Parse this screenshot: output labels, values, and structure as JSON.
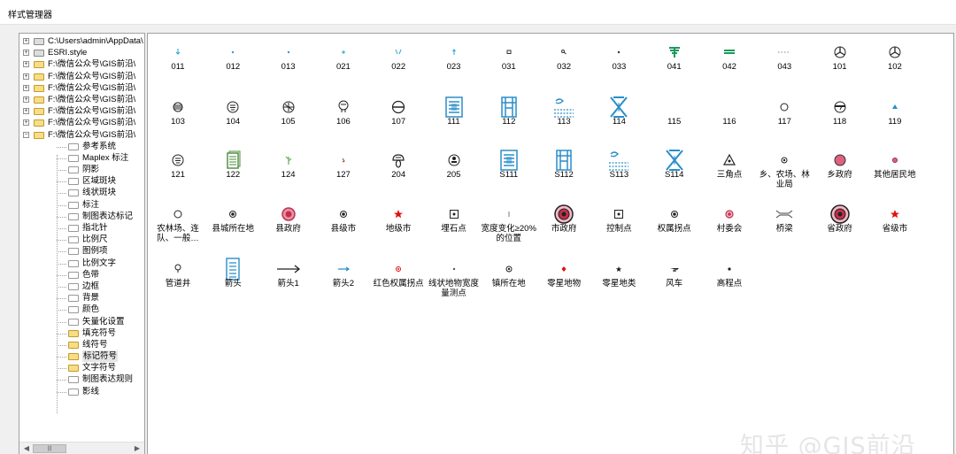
{
  "window": {
    "title": "样式管理器"
  },
  "tree": {
    "top_items": [
      {
        "label": "C:\\Users\\admin\\AppData\\",
        "folder": "gray",
        "expander": "+"
      },
      {
        "label": "ESRI.style",
        "folder": "gray",
        "expander": "+"
      },
      {
        "label": "F:\\微信公众号\\GIS前沿\\",
        "folder": "yellow",
        "expander": "+"
      },
      {
        "label": "F:\\微信公众号\\GIS前沿\\",
        "folder": "yellow",
        "expander": "+"
      },
      {
        "label": "F:\\微信公众号\\GIS前沿\\",
        "folder": "yellow",
        "expander": "+"
      },
      {
        "label": "F:\\微信公众号\\GIS前沿\\",
        "folder": "yellow",
        "expander": "+"
      },
      {
        "label": "F:\\微信公众号\\GIS前沿\\",
        "folder": "yellow",
        "expander": "+"
      },
      {
        "label": "F:\\微信公众号\\GIS前沿\\",
        "folder": "yellow",
        "expander": "+"
      },
      {
        "label": "F:\\微信公众号\\GIS前沿\\",
        "folder": "yellow",
        "expander": "−"
      }
    ],
    "children": [
      {
        "label": "参考系统",
        "folder": "white"
      },
      {
        "label": "Maplex 标注",
        "folder": "white"
      },
      {
        "label": "阴影",
        "folder": "white"
      },
      {
        "label": "区域斑块",
        "folder": "white"
      },
      {
        "label": "线状斑块",
        "folder": "white"
      },
      {
        "label": "标注",
        "folder": "white"
      },
      {
        "label": "制图表达标记",
        "folder": "white"
      },
      {
        "label": "指北针",
        "folder": "white"
      },
      {
        "label": "比例尺",
        "folder": "white"
      },
      {
        "label": "图例项",
        "folder": "white"
      },
      {
        "label": "比例文字",
        "folder": "white"
      },
      {
        "label": "色带",
        "folder": "white"
      },
      {
        "label": "边框",
        "folder": "white"
      },
      {
        "label": "背景",
        "folder": "white"
      },
      {
        "label": "颜色",
        "folder": "white"
      },
      {
        "label": "矢量化设置",
        "folder": "white"
      },
      {
        "label": "填充符号",
        "folder": "yellow"
      },
      {
        "label": "线符号",
        "folder": "yellow"
      },
      {
        "label": "标记符号",
        "folder": "open",
        "selected": true
      },
      {
        "label": "文字符号",
        "folder": "yellow"
      },
      {
        "label": "制图表达规则",
        "folder": "white"
      },
      {
        "label": "影线",
        "folder": "white"
      }
    ],
    "scroll_thumb": "|||"
  },
  "symbols": [
    {
      "label": "011",
      "icon": "small-arrow-down-icon",
      "color": "#27a0d0"
    },
    {
      "label": "012",
      "icon": "tiny-dot-icon",
      "color": "#27a0d0"
    },
    {
      "label": "013",
      "icon": "tiny-dot-icon",
      "color": "#27a0d0"
    },
    {
      "label": "021",
      "icon": "tiny-plus-icon",
      "color": "#27a0d0"
    },
    {
      "label": "022",
      "icon": "v-mark-icon",
      "color": "#27a0d0"
    },
    {
      "label": "023",
      "icon": "tiny-arrow-up-icon",
      "color": "#27a0d0"
    },
    {
      "label": "031",
      "icon": "small-square-icon",
      "color": "#333333"
    },
    {
      "label": "032",
      "icon": "small-dot-tail-icon",
      "color": "#333333"
    },
    {
      "label": "033",
      "icon": "tiny-dot-icon",
      "color": "#333333"
    },
    {
      "label": "041",
      "icon": "green-tree-icon",
      "color": "#1a9a5a"
    },
    {
      "label": "042",
      "icon": "green-bars-icon",
      "color": "#1a9a5a"
    },
    {
      "label": "043",
      "icon": "dotted-line-icon",
      "color": "#888888"
    },
    {
      "label": "101",
      "icon": "propeller-icon",
      "color": "#222222"
    },
    {
      "label": "102",
      "icon": "propeller-icon",
      "color": "#222222"
    },
    {
      "label": "103",
      "icon": "circle-hatch-icon",
      "color": "#222222"
    },
    {
      "label": "104",
      "icon": "circle-text-icon",
      "color": "#222222"
    },
    {
      "label": "105",
      "icon": "circle-plane-icon",
      "color": "#222222"
    },
    {
      "label": "106",
      "icon": "bulb-icon",
      "color": "#222222"
    },
    {
      "label": "107",
      "icon": "circle-bar-icon",
      "color": "#222222"
    },
    {
      "label": "111",
      "icon": "blue-building-icon",
      "color": "#2a8ec8"
    },
    {
      "label": "112",
      "icon": "blue-gate-icon",
      "color": "#2a8ec8"
    },
    {
      "label": "113",
      "icon": "blue-wave-icon",
      "color": "#2a8ec8"
    },
    {
      "label": "114",
      "icon": "blue-cross-icon",
      "color": "#2a8ec8"
    },
    {
      "label": "115",
      "icon": "none",
      "color": "#ffffff"
    },
    {
      "label": "116",
      "icon": "none",
      "color": "#ffffff"
    },
    {
      "label": "117",
      "icon": "hollow-circle-icon",
      "color": "#222222"
    },
    {
      "label": "118",
      "icon": "circle-flag-icon",
      "color": "#222222"
    },
    {
      "label": "119",
      "icon": "blue-triangle-icon",
      "color": "#2a8ec8"
    },
    {
      "label": "121",
      "icon": "circle-text-icon",
      "color": "#222222"
    },
    {
      "label": "122",
      "icon": "green-doc-icon",
      "color": "#4a8a3a"
    },
    {
      "label": "124",
      "icon": "green-sprout-icon",
      "color": "#6aaa5a"
    },
    {
      "label": "127",
      "icon": "tiny-mark-icon",
      "color": "#884422"
    },
    {
      "label": "204",
      "icon": "cloud-drop-icon",
      "color": "#222222"
    },
    {
      "label": "205",
      "icon": "circle-person-icon",
      "color": "#222222"
    },
    {
      "label": "S111",
      "icon": "blue-building-icon",
      "color": "#2a8ec8"
    },
    {
      "label": "S112",
      "icon": "blue-gate-icon",
      "color": "#2a8ec8"
    },
    {
      "label": "S113",
      "icon": "blue-wave-icon",
      "color": "#2a8ec8"
    },
    {
      "label": "S114",
      "icon": "blue-cross-icon",
      "color": "#2a8ec8"
    },
    {
      "label": "三角点",
      "icon": "triangle-dot-icon",
      "color": "#222222"
    },
    {
      "label": "乡、农场、林业局",
      "icon": "small-target-icon",
      "color": "#222222"
    },
    {
      "label": "乡政府",
      "icon": "pink-circle-icon",
      "color": "#e06080"
    },
    {
      "label": "其他居民地",
      "icon": "small-pink-dot-icon",
      "color": "#c05070"
    },
    {
      "label": "农林场、连队、一般…",
      "icon": "hollow-circle-icon",
      "color": "#222222"
    },
    {
      "label": "县城所在地",
      "icon": "dot-in-circle-icon",
      "color": "#222222"
    },
    {
      "label": "县政府",
      "icon": "red-ring-icon",
      "color": "#c0304a"
    },
    {
      "label": "县级市",
      "icon": "dot-in-circle-icon",
      "color": "#222222"
    },
    {
      "label": "地级市",
      "icon": "red-star-icon",
      "color": "#e01010"
    },
    {
      "label": "埋石点",
      "icon": "boxed-dot-icon",
      "color": "#222222"
    },
    {
      "label": "宽度变化≥20%的位置",
      "icon": "tick-icon",
      "color": "#777777"
    },
    {
      "label": "市政府",
      "icon": "big-red-ring-icon",
      "color": "#c0304a"
    },
    {
      "label": "控制点",
      "icon": "boxed-dot-icon",
      "color": "#222222"
    },
    {
      "label": "权属拐点",
      "icon": "dot-in-circle-icon",
      "color": "#222222"
    },
    {
      "label": "村委会",
      "icon": "small-red-ring-icon",
      "color": "#c0304a"
    },
    {
      "label": "桥梁",
      "icon": "bridge-icon",
      "color": "#444444"
    },
    {
      "label": "省政府",
      "icon": "big-red-ring-icon",
      "color": "#c0304a"
    },
    {
      "label": "省级市",
      "icon": "red-star-icon",
      "color": "#e01010"
    },
    {
      "label": "管道井",
      "icon": "bulb-small-icon",
      "color": "#222222"
    },
    {
      "label": "箭头",
      "icon": "blue-list-icon",
      "color": "#2a8ec8"
    },
    {
      "label": "箭头1",
      "icon": "long-arrow-icon",
      "color": "#222222"
    },
    {
      "label": "箭头2",
      "icon": "blue-arrow-icon",
      "color": "#2a8ec8"
    },
    {
      "label": "红色权属拐点",
      "icon": "small-red-target-icon",
      "color": "#e01010"
    },
    {
      "label": "线状地物宽度量测点",
      "icon": "tiny-dot-icon",
      "color": "#555555"
    },
    {
      "label": "镇所在地",
      "icon": "small-target-icon",
      "color": "#222222"
    },
    {
      "label": "零星地物",
      "icon": "red-diamond-icon",
      "color": "#e01010"
    },
    {
      "label": "零星地类",
      "icon": "small-star-icon",
      "color": "#222222"
    },
    {
      "label": "风车",
      "icon": "windmill-icon",
      "color": "#222222"
    },
    {
      "label": "高程点",
      "icon": "tiny-black-dot-icon",
      "color": "#222222"
    }
  ],
  "watermark": "知乎 @GIS前沿"
}
